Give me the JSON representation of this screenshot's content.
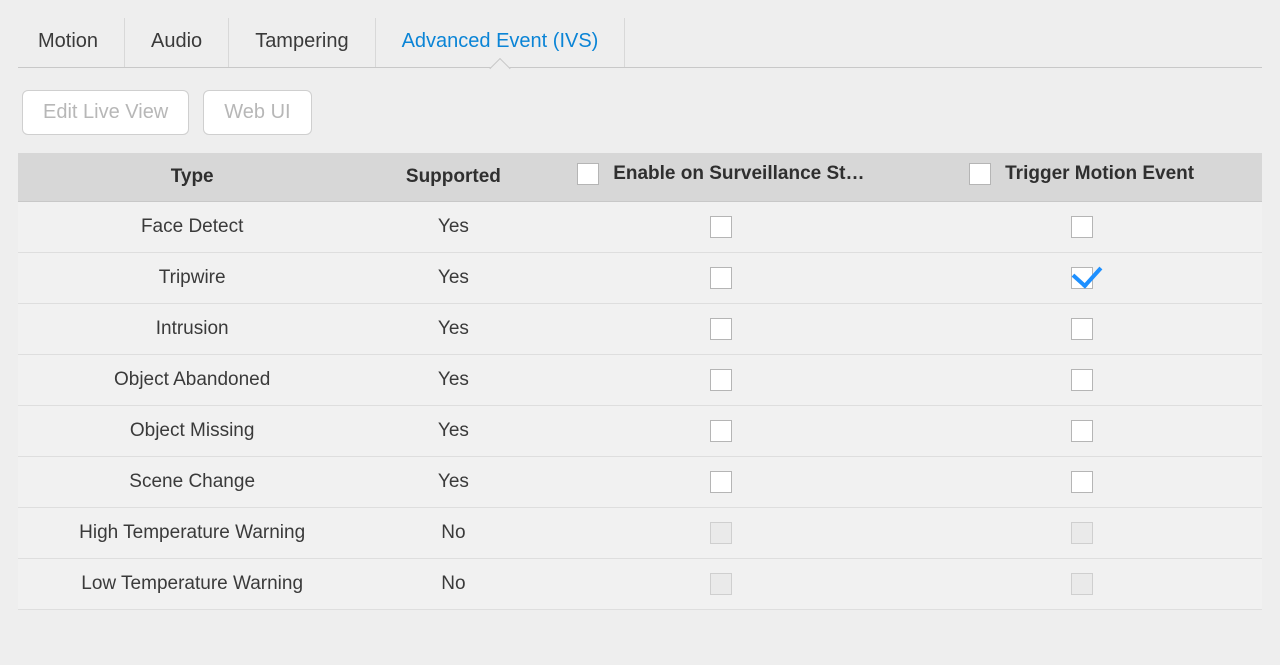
{
  "tabs": [
    {
      "label": "Motion",
      "active": false
    },
    {
      "label": "Audio",
      "active": false
    },
    {
      "label": "Tampering",
      "active": false
    },
    {
      "label": "Advanced Event (IVS)",
      "active": true
    }
  ],
  "toolbar": {
    "edit_live_view": "Edit Live View",
    "web_ui": "Web UI"
  },
  "columns": {
    "type": "Type",
    "supported": "Supported",
    "enable": "Enable on Surveillance St…",
    "trigger": "Trigger Motion Event"
  },
  "header_checks": {
    "enable": false,
    "trigger": false
  },
  "rows": [
    {
      "type": "Face Detect",
      "supported": "Yes",
      "enable_ck": false,
      "trigger_ck": false,
      "disabled": false
    },
    {
      "type": "Tripwire",
      "supported": "Yes",
      "enable_ck": false,
      "trigger_ck": true,
      "disabled": false
    },
    {
      "type": "Intrusion",
      "supported": "Yes",
      "enable_ck": false,
      "trigger_ck": false,
      "disabled": false
    },
    {
      "type": "Object Abandoned",
      "supported": "Yes",
      "enable_ck": false,
      "trigger_ck": false,
      "disabled": false
    },
    {
      "type": "Object Missing",
      "supported": "Yes",
      "enable_ck": false,
      "trigger_ck": false,
      "disabled": false
    },
    {
      "type": "Scene Change",
      "supported": "Yes",
      "enable_ck": false,
      "trigger_ck": false,
      "disabled": false
    },
    {
      "type": "High Temperature Warning",
      "supported": "No",
      "enable_ck": false,
      "trigger_ck": false,
      "disabled": true
    },
    {
      "type": "Low Temperature Warning",
      "supported": "No",
      "enable_ck": false,
      "trigger_ck": false,
      "disabled": true
    }
  ]
}
